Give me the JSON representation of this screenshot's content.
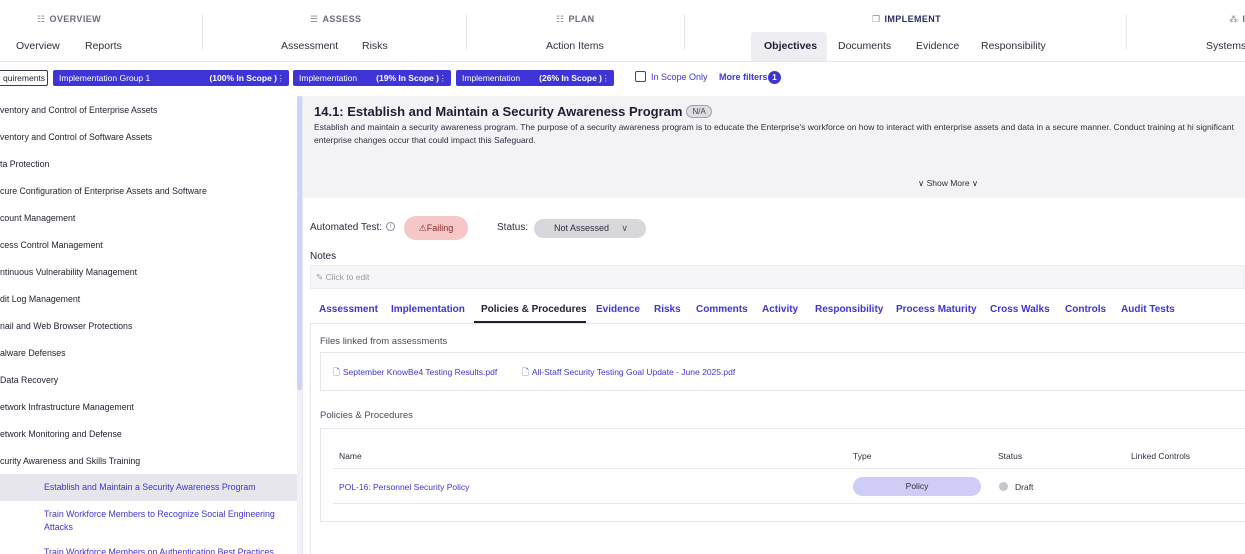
{
  "topnav": {
    "groups": {
      "overview": {
        "icon": "☷",
        "label": "OVERVIEW"
      },
      "assess": {
        "icon": "☰",
        "label": "ASSESS"
      },
      "plan": {
        "icon": "☷",
        "label": "PLAN"
      },
      "implement": {
        "icon": "❐",
        "label": "IMPLEMENT"
      },
      "next": {
        "icon": "⁂",
        "label": "I"
      }
    },
    "items": {
      "overview": "Overview",
      "reports": "Reports",
      "assessment": "Assessment",
      "risks": "Risks",
      "action_items": "Action Items",
      "objectives": "Objectives",
      "documents": "Documents",
      "evidence": "Evidence",
      "responsibility": "Responsibility",
      "systems": "Systems"
    }
  },
  "filters": {
    "requirements": "quirements",
    "chips": [
      {
        "label": "Implementation Group 1",
        "pct": "(100% In Scope )"
      },
      {
        "label": "Implementation",
        "pct": "(19% In Scope )"
      },
      {
        "label": "Implementation",
        "pct": "(26% In Scope )"
      }
    ],
    "in_scope_only": "In Scope Only",
    "more_filters": "More filters",
    "more_filters_count": "1"
  },
  "sidebar": {
    "items": [
      "ventory and Control of Enterprise Assets",
      "ventory and Control of Software Assets",
      "ta Protection",
      "cure Configuration of Enterprise Assets and Software",
      "count Management",
      "cess Control Management",
      "ntinuous Vulnerability Management",
      "dit Log Management",
      "nail and Web Browser Protections",
      "alware Defenses",
      "Data Recovery",
      "etwork Infrastructure Management",
      "etwork Monitoring and Defense",
      "curity Awareness and Skills Training"
    ],
    "sub_items": [
      "Establish and Maintain a Security Awareness Program",
      "Train Workforce Members to Recognize Social Engineering Attacks",
      "Train Workforce Members on Authentication Best Practices"
    ]
  },
  "safeguard": {
    "title": "14.1: Establish and Maintain a Security Awareness Program",
    "badge": "N/A",
    "description": "Establish and maintain a security awareness program. The purpose of a security awareness program is to educate the Enterprise's workforce on how to interact with enterprise assets and data in a secure manner. Conduct training at hi significant enterprise changes occur that could impact this Safeguard.",
    "show_more": "∨ Show More ∨"
  },
  "status_row": {
    "automated_test_label": "Automated Test:",
    "info": "i",
    "failing": "⚠Failing",
    "status_label": "Status:",
    "status_value": "Not Assessed",
    "status_chevron": "∨"
  },
  "notes": {
    "label": "Notes",
    "placeholder": "✎  Click to edit"
  },
  "tabs": [
    "Assessment",
    "Implementation",
    "Policies & Procedures",
    "Evidence",
    "Risks",
    "Comments",
    "Activity",
    "Responsibility",
    "Process Maturity",
    "Cross Walks",
    "Controls",
    "Audit Tests"
  ],
  "files": {
    "title": "Files linked from assessments",
    "file_icon": "🗋",
    "items": [
      "September KnowBe4 Testing Results.pdf",
      "All-Staff Security Testing Goal Update - June 2025.pdf"
    ]
  },
  "policies": {
    "title": "Policies & Procedures",
    "columns": [
      "Name",
      "Type",
      "Status",
      "Linked Controls"
    ],
    "rows": [
      {
        "name": "POL-16: Personnel Security Policy",
        "type": "Policy",
        "status": "Draft"
      }
    ]
  },
  "colors": {
    "accent": "#3f35d6",
    "failing_bg": "#f6c7c7",
    "policy_pill": "#cfccf6"
  }
}
